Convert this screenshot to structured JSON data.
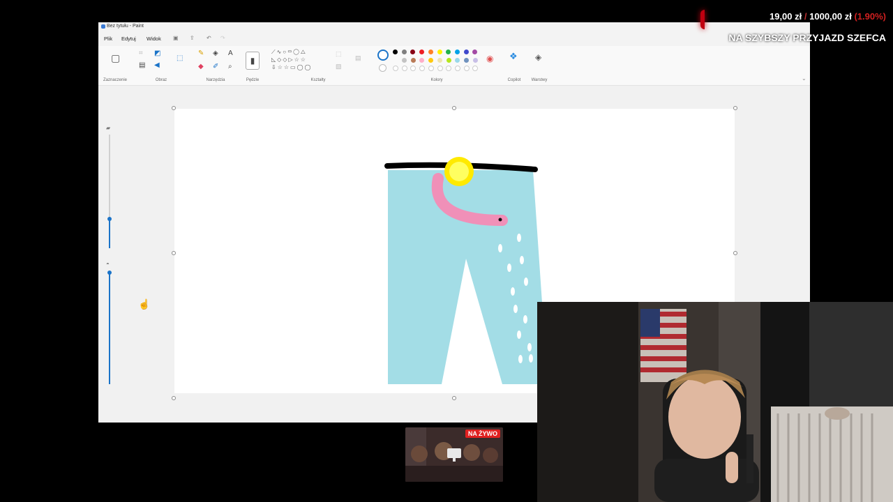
{
  "window": {
    "title": "Bez tytułu - Paint"
  },
  "menu": {
    "items": [
      "Plik",
      "Edytuj",
      "Widok"
    ]
  },
  "ribbon": {
    "groups": [
      "Zaznaczenie",
      "Obraz",
      "Narzędzia",
      "Pędzle",
      "Kształty",
      "Kolory",
      "Copilot",
      "Warstwy"
    ],
    "palette": [
      "#000000",
      "#7f7f7f",
      "#880015",
      "#ed1c24",
      "#ff7f27",
      "#fff200",
      "#22b14c",
      "#00a2e8",
      "#3f48cc",
      "#a349a4"
    ],
    "palette_light": [
      "#c3c3c3",
      "#b97a57",
      "#ffaec9",
      "#ffc90e",
      "#efe4b0",
      "#b5e61d",
      "#99d9ea",
      "#7092be",
      "#c8bfe7"
    ]
  },
  "overlay": {
    "donation_current": "19,00 zł",
    "donation_separator": "/",
    "donation_goal": "1000,00 zł",
    "donation_percent": "(1.90%)",
    "donation_progress": 0.019,
    "goal_title": "NA SZYBSZY PRZYJAZD SZEFCA"
  },
  "live_badge": "NA ŻYWO",
  "icons": {
    "select": "rectangle-select-icon",
    "pencil": "pencil-icon",
    "fill": "fill-bucket-icon",
    "text": "text-icon",
    "eraser": "eraser-icon",
    "picker": "color-picker-icon",
    "zoom": "magnifier-icon",
    "brush": "brush-icon",
    "copilot": "copilot-icon",
    "layers": "layers-icon"
  }
}
